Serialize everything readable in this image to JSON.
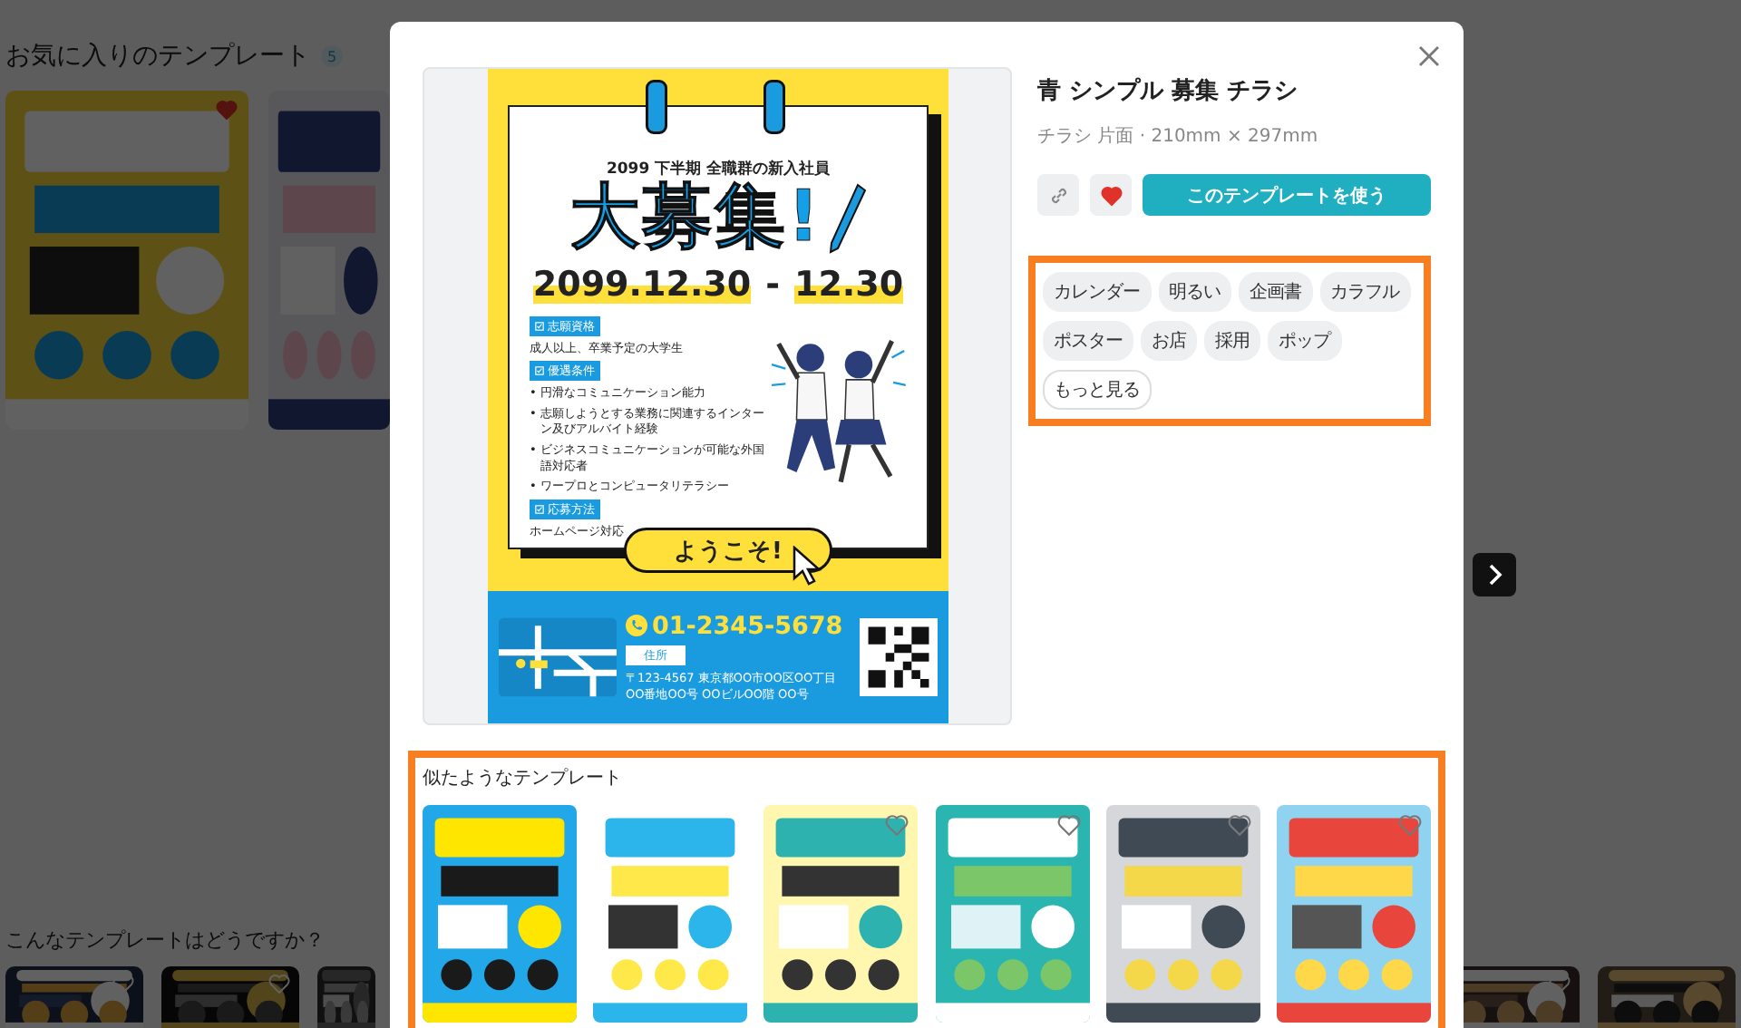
{
  "background": {
    "favorites": {
      "title": "お気に入りのテンプレート",
      "count": "5",
      "cards": [
        {
          "kind": "picture",
          "liked": true
        },
        {
          "kind": "picture",
          "liked": false
        }
      ]
    },
    "suggestions": {
      "title": "こんなテンプレートはどうですか？",
      "left_cards": [
        {
          "kind": "picture",
          "heart": true
        },
        {
          "kind": "picture",
          "heart": true
        },
        {
          "kind": "picture",
          "heart": false
        }
      ],
      "right_cards": [
        {
          "kind": "picture",
          "heart": true
        },
        {
          "kind": "picture",
          "heart": false
        }
      ]
    }
  },
  "modal": {
    "preview": {
      "kind": "flyer",
      "headline_sub": "2099 下半期 全職群の新入社員",
      "headline": "大募集!",
      "date_start": "2099.12.30",
      "date_sep": "-",
      "date_end": "12.30",
      "sections": [
        {
          "kind": "text",
          "label": "志願資格",
          "lines": [
            "成人以上、卒業予定の大学生"
          ]
        },
        {
          "kind": "bullets",
          "label": "優遇条件",
          "marker": "•",
          "lines": [
            "円滑なコミュニケーション能力",
            "志願しようとする業務に関連するインターン及びアルバイト経験",
            "ビジネスコミュニケーションが可能な外国語対応者",
            "ワープロとコンピュータリテラシー"
          ]
        },
        {
          "kind": "text",
          "label": "応募方法",
          "lines": [
            "ホームページ対応"
          ]
        }
      ],
      "welcome": "ようこそ!",
      "phone": "01-2345-5678",
      "address_label": "住所",
      "address": "〒123-4567 東京都OO市OO区OO丁目OO番地OO号 OOビルOO階 OO号"
    },
    "title": "青 シンプル 募集 チラシ",
    "subtitle": "チラシ 片面 · 210mm × 297mm",
    "liked": true,
    "use_button": "このテンプレートを使う",
    "tags": [
      "カレンダー",
      "明るい",
      "企画書",
      "カラフル",
      "ポスター",
      "お店",
      "採用",
      "ポップ"
    ],
    "more_tags": "もっと見る",
    "similar": {
      "title": "似たようなテンプレート",
      "items": [
        {
          "kind": "picture",
          "heart": false
        },
        {
          "kind": "picture",
          "heart": false
        },
        {
          "kind": "picture",
          "heart": true
        },
        {
          "kind": "picture",
          "heart": true
        },
        {
          "kind": "picture",
          "heart": true
        },
        {
          "kind": "picture",
          "heart": true
        }
      ]
    }
  }
}
